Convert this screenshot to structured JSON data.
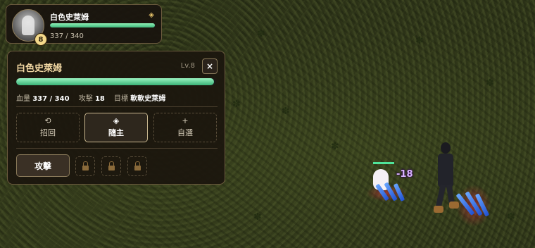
{
  "pet_card": {
    "name": "白色史萊姆",
    "level_badge": "8",
    "hp_text": "337 / 340",
    "hp_fraction": 0.991,
    "mode_icon": "diamond-icon"
  },
  "pet_panel": {
    "title": "白色史萊姆",
    "level": "Lv.8",
    "close_label": "×",
    "hp_fraction": 0.991,
    "stats": {
      "hp_label": "血量",
      "hp_value": "337 / 340",
      "attack_label": "攻擊",
      "attack_value": "18",
      "target_label": "目標",
      "target_value": "軟軟史萊姆"
    },
    "modes": [
      {
        "label": "招回",
        "icon": "recall-icon",
        "glyph": "⟲",
        "active": false
      },
      {
        "label": "隨主",
        "icon": "follow-icon",
        "glyph": "◈",
        "active": true
      },
      {
        "label": "自選",
        "icon": "plus-icon",
        "glyph": "+",
        "active": false
      }
    ],
    "attack_label": "攻擊",
    "locked_slots": 3
  },
  "battle": {
    "damage_text": "-18",
    "colors": {
      "hp_green": "#4fe39a",
      "damage_purple": "#d9b3ff",
      "accent_gold": "#f3d9a4"
    }
  }
}
